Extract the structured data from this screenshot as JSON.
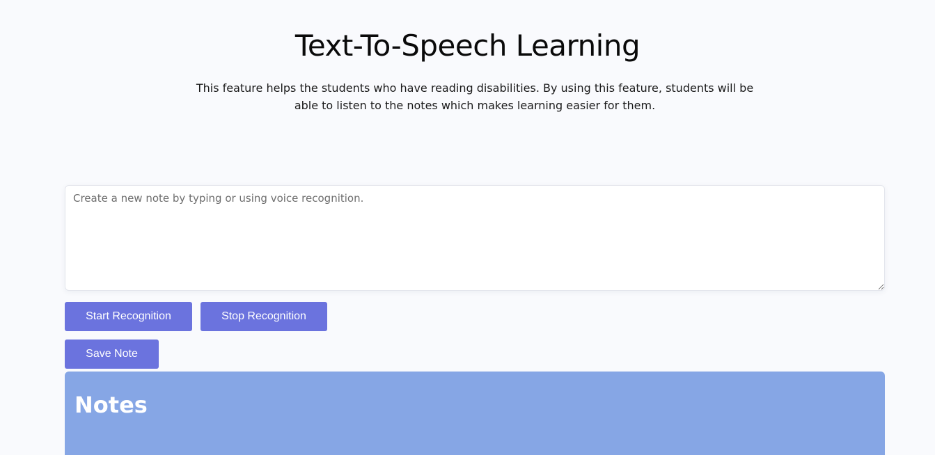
{
  "header": {
    "title": "Text-To-Speech Learning",
    "description": "This feature helps the students who have reading disabilities. By using this feature, students will be able to listen to the notes which makes learning easier for them."
  },
  "note_input": {
    "value": "",
    "placeholder": "Create a new note by typing or using voice recognition."
  },
  "controls": {
    "start_label": "Start Recognition",
    "stop_label": "Stop Recognition",
    "save_label": "Save Note"
  },
  "notes": {
    "heading": "Notes"
  },
  "colors": {
    "button": "#6b73de",
    "notes_panel": "#86a6e5",
    "background": "#f9fafd"
  }
}
